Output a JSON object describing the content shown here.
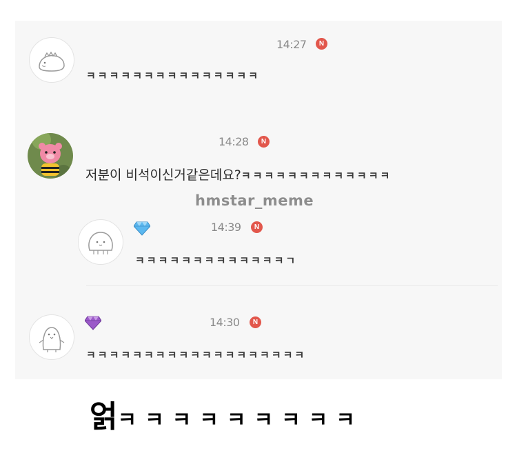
{
  "watermark": "hmstar_meme",
  "messages": [
    {
      "avatar": "dinosaur-avatar",
      "time": "14:27",
      "badge": "N",
      "text": "ㅋㅋㅋㅋㅋㅋㅋㅋㅋㅋㅋㅋㅋㅋㅋ"
    },
    {
      "avatar": "bear-plush-avatar",
      "time": "14:28",
      "badge": "N",
      "text_prefix": "저분이 비석이신거같은데요?",
      "text_suffix": "ㅋㅋㅋㅋㅋㅋㅋㅋㅋㅋㅋㅋㅋ"
    },
    {
      "avatar": "blob-face-avatar",
      "gem": "blue-diamond-icon",
      "time": "14:39",
      "badge": "N",
      "text": "ㅋㅋㅋㅋㅋㅋㅋㅋㅋㅋㅋㅋㅋㄱ"
    },
    {
      "avatar": "penguin-avatar",
      "gem": "purple-gem-icon",
      "time": "14:30",
      "badge": "N",
      "text": "ㅋㅋㅋㅋㅋㅋㅋㅋㅋㅋㅋㅋㅋㅋㅋㅋㅋㅋㅋ"
    }
  ],
  "caption": {
    "word": "얽",
    "laugh": "ㅋㅋㅋㅋㅋㅋㅋㅋㅋ"
  },
  "colors": {
    "panel_bg": "#f7f7f7",
    "badge_red": "#e2574c",
    "timestamp_gray": "#8a8a8a",
    "blue_gem": "#5bb8f0",
    "purple_gem": "#9b59c9"
  }
}
